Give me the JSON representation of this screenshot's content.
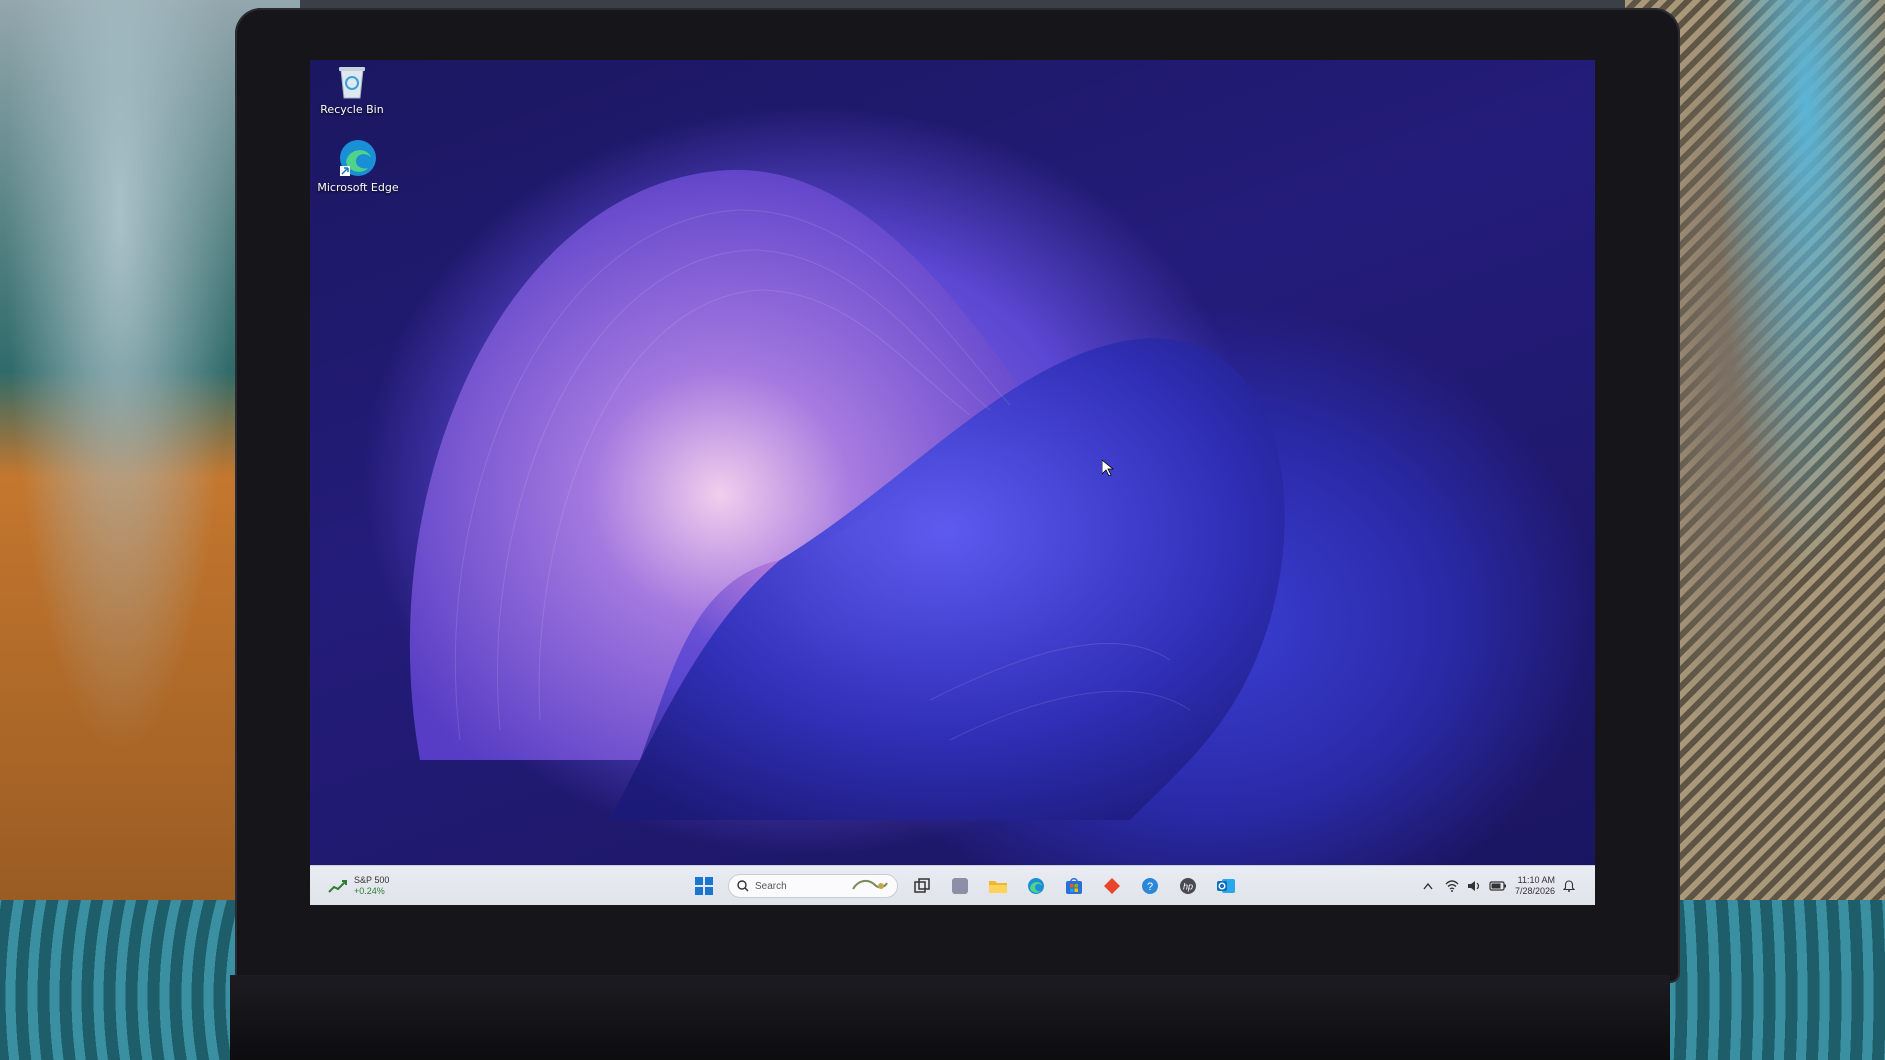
{
  "desktop": {
    "icons": [
      {
        "label": "Recycle Bin",
        "icon": "recycle-bin-icon"
      },
      {
        "label": "Microsoft Edge",
        "icon": "edge-icon"
      }
    ]
  },
  "taskbar": {
    "widget": {
      "name": "S&P 500",
      "change": "+0.24%",
      "icon": "stock-chart-icon"
    },
    "search": {
      "placeholder": "Search"
    },
    "pinned": [
      "start-icon",
      "task-view-icon",
      "widgets-icon",
      "file-explorer-icon",
      "edge-icon",
      "store-icon",
      "office-icon",
      "help-icon",
      "hp-icon",
      "outlook-icon"
    ],
    "tray": {
      "time": "11:10 AM",
      "date": "7/28/2026"
    }
  },
  "colors": {
    "taskbar_bg": "#e9ecf2",
    "accent": "#1976d2",
    "wallpaper_deep": "#1b1760"
  }
}
